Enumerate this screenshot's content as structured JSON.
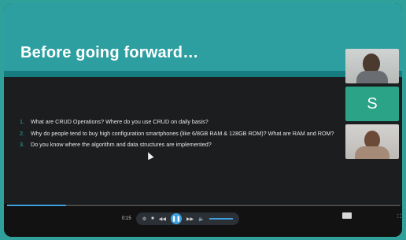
{
  "slide": {
    "title": "Before going forward…",
    "bullets": [
      {
        "num": "1.",
        "text": "What are CRUD Operations? Where do you use CRUD on daily basis?"
      },
      {
        "num": "2.",
        "text": "Why do people tend to buy high configuration smartphones (like 6/8GB RAM & 128GB ROM)? What are RAM and ROM?"
      },
      {
        "num": "3.",
        "text": "Do you know where the algorithm and data structures are implemented?"
      }
    ]
  },
  "participants": {
    "avatar_letter": "S",
    "avatar_color": "#2aa386"
  },
  "player": {
    "progress_fraction": 0.15,
    "time_label": "0:15",
    "accent": "#3fa0e0"
  },
  "colors": {
    "banner": "#2e9fa0",
    "background": "#1b1d1f",
    "number_accent": "#2fb0b0"
  }
}
